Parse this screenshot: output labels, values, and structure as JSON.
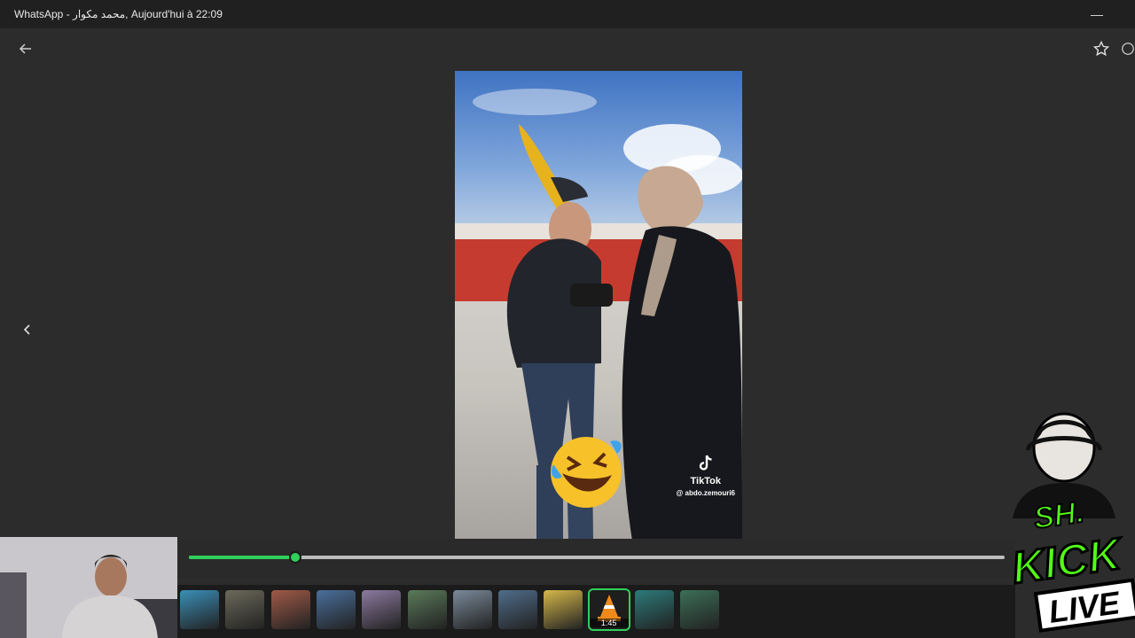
{
  "window": {
    "title": "WhatsApp - محمد مكوار, Aujourd'hui à 22:09",
    "minimize_glyph": "—"
  },
  "viewer": {
    "back_icon": "arrow-left-icon",
    "favorite_icon": "star-icon",
    "prev_icon": "chevron-left-icon",
    "overflow_icon": "more-icon"
  },
  "media": {
    "watermark_app": "TikTok",
    "watermark_user": "@ abdo.zemouri6",
    "overlay_emoji": "rolling-on-floor-laughing"
  },
  "player": {
    "progress_fraction": 0.13,
    "accent_color": "#2ed15b"
  },
  "taskbar": {
    "items": [
      {
        "name": "app-1",
        "color": "#3a8fb8"
      },
      {
        "name": "app-2",
        "color": "#6c6a5a"
      },
      {
        "name": "app-3",
        "color": "#a05a48"
      },
      {
        "name": "app-4",
        "color": "#4a6f9c"
      },
      {
        "name": "app-5",
        "color": "#8c7aa0"
      },
      {
        "name": "app-6",
        "color": "#5a7a5a"
      },
      {
        "name": "app-7",
        "color": "#7a8a9a"
      },
      {
        "name": "app-8",
        "color": "#4f6d8a"
      },
      {
        "name": "app-9",
        "color": "#d6b84a"
      },
      {
        "name": "vlc",
        "color": "#f08a1c",
        "time": "1:45",
        "active": true
      },
      {
        "name": "app-11",
        "color": "#2d7a7a"
      },
      {
        "name": "app-12",
        "color": "#3c6f58"
      }
    ]
  },
  "overlay": {
    "brand_top": "SH.",
    "brand_main": "KICK",
    "brand_live": "LIVE"
  }
}
